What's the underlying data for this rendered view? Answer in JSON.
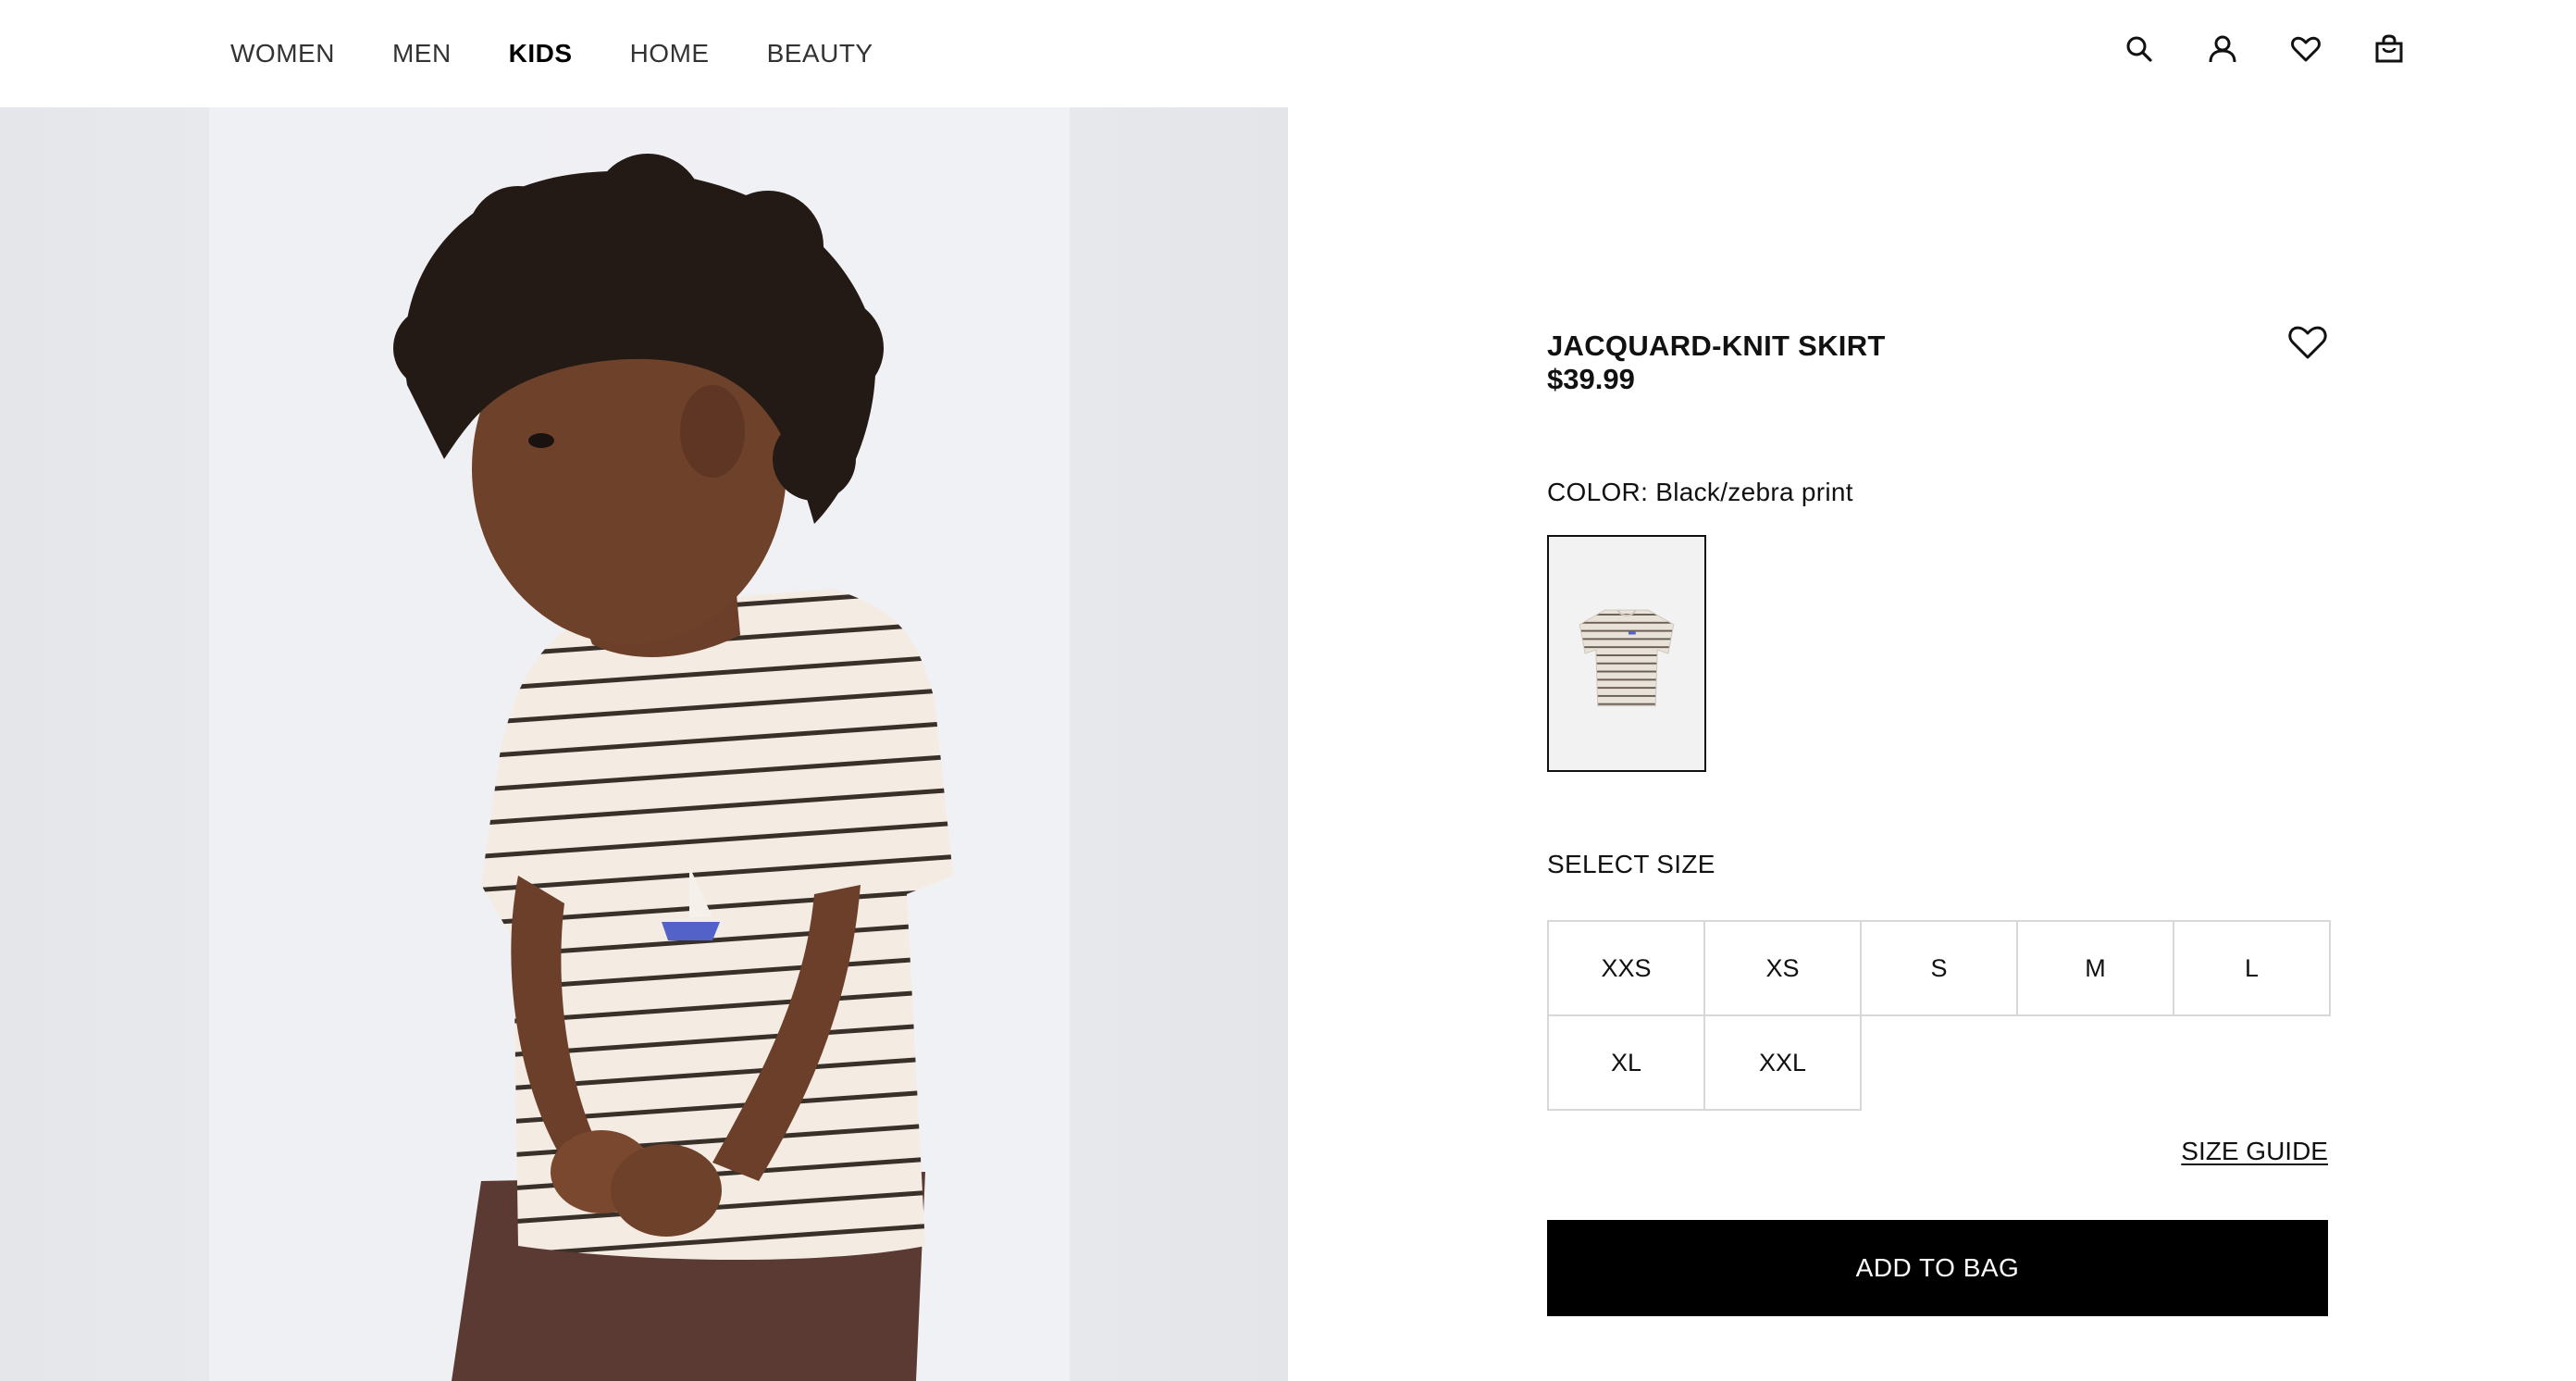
{
  "nav": {
    "items": [
      {
        "label": "WOMEN",
        "active": false
      },
      {
        "label": "MEN",
        "active": false
      },
      {
        "label": "KIDS",
        "active": true
      },
      {
        "label": "HOME",
        "active": false
      },
      {
        "label": "BEAUTY",
        "active": false
      }
    ]
  },
  "header_icons": [
    "search-icon",
    "account-icon",
    "wishlist-icon",
    "shopping-bag-icon"
  ],
  "product": {
    "title": "JACQUARD-KNIT SKIRT",
    "price": "$39.99",
    "color_label": "COLOR: Black/zebra print",
    "size_label": "SELECT SIZE",
    "sizes": [
      "XXS",
      "XS",
      "S",
      "M",
      "L",
      "XL",
      "XXL"
    ],
    "size_guide": "SIZE GUIDE",
    "add_to_bag": "ADD TO BAG"
  },
  "colors": {
    "accent": "#000000",
    "text": "#111111",
    "border": "#d8d8d8",
    "image_bg": "#eff0f3"
  }
}
